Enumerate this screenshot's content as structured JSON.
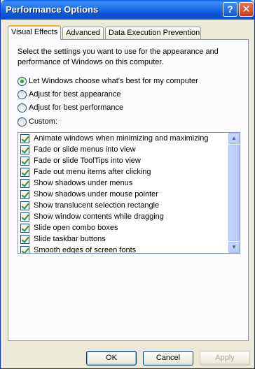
{
  "window": {
    "title": "Performance Options",
    "help_glyph": "?",
    "close_glyph": "✕"
  },
  "tabs": [
    {
      "label": "Visual Effects",
      "active": true
    },
    {
      "label": "Advanced",
      "active": false
    },
    {
      "label": "Data Execution Prevention",
      "active": false
    }
  ],
  "description": "Select the settings you want to use for the appearance and performance of Windows on this computer.",
  "radios": [
    {
      "label": "Let Windows choose what's best for my computer",
      "selected": true
    },
    {
      "label": "Adjust for best appearance",
      "selected": false
    },
    {
      "label": "Adjust for best performance",
      "selected": false
    },
    {
      "label": "Custom:",
      "selected": false
    }
  ],
  "effects": [
    {
      "label": "Animate windows when minimizing and maximizing",
      "checked": true
    },
    {
      "label": "Fade or slide menus into view",
      "checked": true
    },
    {
      "label": "Fade or slide ToolTips into view",
      "checked": true
    },
    {
      "label": "Fade out menu items after clicking",
      "checked": true
    },
    {
      "label": "Show shadows under menus",
      "checked": true
    },
    {
      "label": "Show shadows under mouse pointer",
      "checked": true
    },
    {
      "label": "Show translucent selection rectangle",
      "checked": true
    },
    {
      "label": "Show window contents while dragging",
      "checked": true
    },
    {
      "label": "Slide open combo boxes",
      "checked": true
    },
    {
      "label": "Slide taskbar buttons",
      "checked": true
    },
    {
      "label": "Smooth edges of screen fonts",
      "checked": true
    }
  ],
  "buttons": {
    "ok": "OK",
    "cancel": "Cancel",
    "apply": "Apply"
  },
  "icons": {
    "scroll_up": "scroll-up-arrow-icon",
    "scroll_down": "scroll-down-arrow-icon"
  }
}
